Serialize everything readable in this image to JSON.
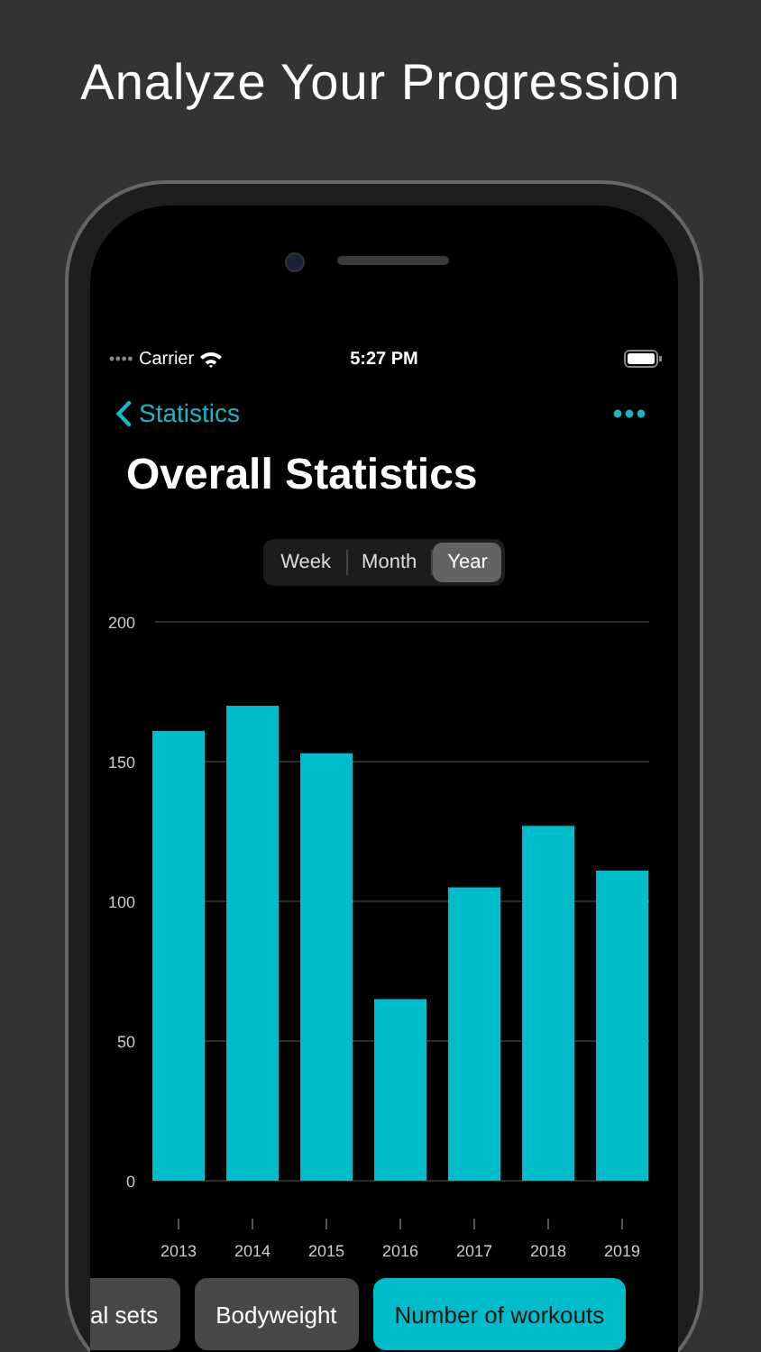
{
  "headline": "Analyze Your Progression",
  "status_bar": {
    "carrier": "Carrier",
    "time": "5:27 PM"
  },
  "nav": {
    "back": "Statistics"
  },
  "title": "Overall Statistics",
  "segments": [
    {
      "label": "Week",
      "selected": false
    },
    {
      "label": "Month",
      "selected": false
    },
    {
      "label": "Year",
      "selected": true
    }
  ],
  "chart_data": {
    "type": "bar",
    "categories": [
      "2013",
      "2014",
      "2015",
      "2016",
      "2017",
      "2018",
      "2019"
    ],
    "series": [
      {
        "color": "#00bccb",
        "values": [
          161,
          170,
          153,
          65,
          105,
          127,
          111
        ]
      }
    ],
    "ylim": [
      0,
      200
    ],
    "grid": true,
    "yticks": [
      0,
      50,
      100,
      150,
      200
    ]
  },
  "chips": [
    {
      "label": "al sets",
      "selected": false
    },
    {
      "label": "Bodyweight",
      "selected": false
    },
    {
      "label": "Number of workouts",
      "selected": true
    }
  ]
}
